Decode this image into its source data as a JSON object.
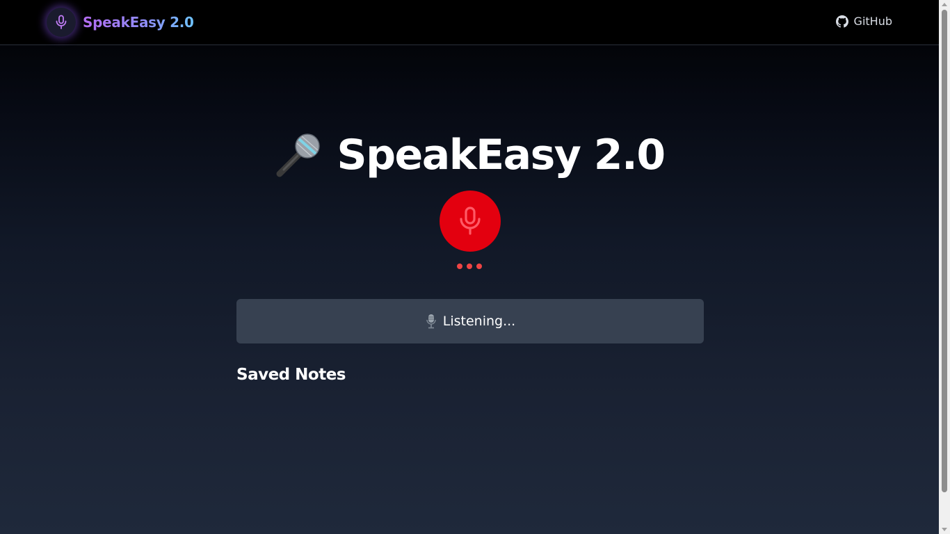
{
  "navbar": {
    "brand_name": "SpeakEasy 2.0",
    "brand_icon": "microphone-icon",
    "links": [
      {
        "label": "GitHub",
        "icon": "github-icon"
      }
    ]
  },
  "hero": {
    "title_emoji": "microphone-emoji-icon",
    "title": "SpeakEasy 2.0"
  },
  "recorder": {
    "button_icon": "microphone-icon",
    "state_color": "#e3000f",
    "indicator": "listening-dots",
    "status_icon": "studio-microphone-icon",
    "status_text": "Listening..."
  },
  "notes": {
    "heading": "Saved Notes",
    "items": []
  },
  "colors": {
    "accent_gradient": [
      "#b36bf0",
      "#6ec3ff"
    ],
    "recording_red": "#e3000f",
    "status_box": "#374151"
  }
}
